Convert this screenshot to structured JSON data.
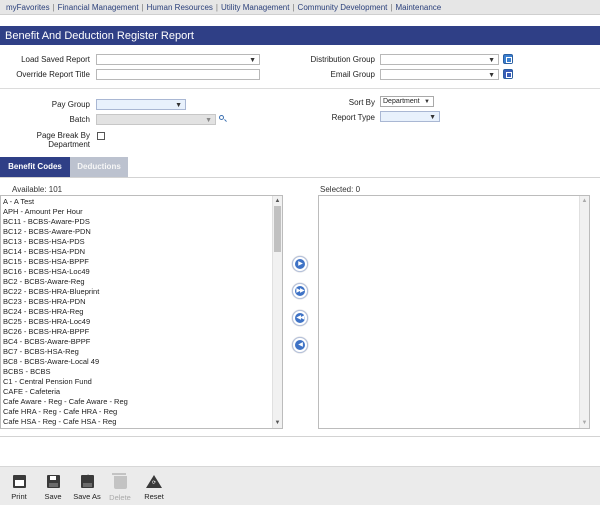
{
  "nav": {
    "items": [
      "myFavorites",
      "Financial Management",
      "Human Resources",
      "Utility Management",
      "Community Development",
      "Maintenance"
    ],
    "separator": "|"
  },
  "page": {
    "title": "Benefit And Deduction Register Report"
  },
  "form": {
    "load_saved_report": {
      "label": "Load Saved Report",
      "value": ""
    },
    "override_report_title": {
      "label": "Override Report Title",
      "value": ""
    },
    "distribution_group": {
      "label": "Distribution Group",
      "value": ""
    },
    "email_group": {
      "label": "Email Group",
      "value": ""
    },
    "pay_group": {
      "label": "Pay Group",
      "value": ""
    },
    "batch": {
      "label": "Batch",
      "value": ""
    },
    "page_break": {
      "label_line1": "Page Break By",
      "label_line2": "Department",
      "checked": false
    },
    "sort_by": {
      "label": "Sort By",
      "value": "Department"
    },
    "report_type": {
      "label": "Report Type",
      "value": ""
    }
  },
  "tabs": [
    {
      "label": "Benefit Codes",
      "active": true
    },
    {
      "label": "Deductions",
      "active": false
    }
  ],
  "available": {
    "caption": "Available: 101",
    "items": [
      "A - A Test",
      "APH - Amount Per Hour",
      "BC11 - BCBS-Aware-PDS",
      "BC12 - BCBS-Aware-PDN",
      "BC13 - BCBS-HSA-PDS",
      "BC14 - BCBS-HSA-PDN",
      "BC15 - BCBS-HSA-BPPF",
      "BC16 - BCBS-HSA-Loc49",
      "BC2 - BCBS-Aware-Reg",
      "BC22 - BCBS-HRA-Blueprint",
      "BC23 - BCBS-HRA-PDN",
      "BC24 - BCBS-HRA-Reg",
      "BC25 - BCBS-HRA-Loc49",
      "BC26 - BCBS-HRA-BPPF",
      "BC4 - BCBS-Aware-BPPF",
      "BC7 - BCBS-HSA-Reg",
      "BC8 - BCBS-Aware-Local 49",
      "BCBS - BCBS",
      "C1 - Central Pension Fund",
      "CAFE - Cafeteria",
      "Cafe Aware - Reg - Cafe Aware - Reg",
      "Cafe HRA - Reg - Cafe HRA - Reg",
      "Cafe HSA - Reg - Cafe HSA - Reg"
    ]
  },
  "selected": {
    "caption": "Selected: 0",
    "items": []
  },
  "toolbar": {
    "print": "Print",
    "save": "Save",
    "save_as": "Save As",
    "delete": "Delete",
    "reset": "Reset"
  }
}
